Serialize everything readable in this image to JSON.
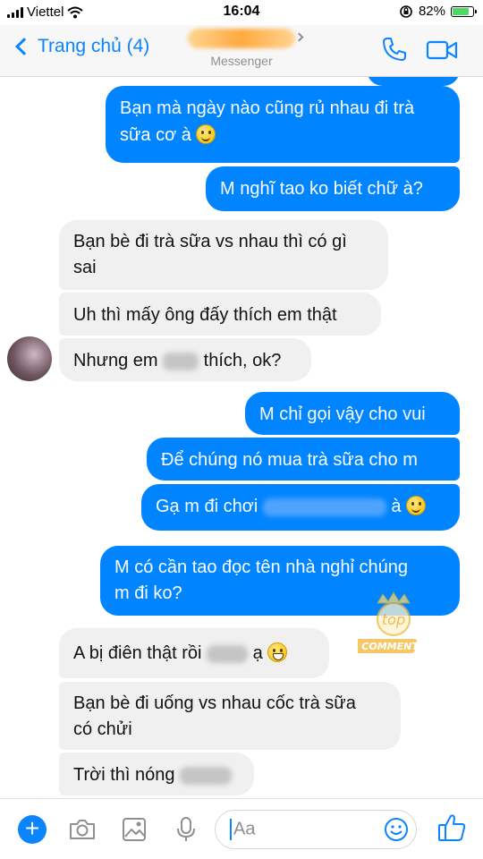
{
  "status_bar": {
    "carrier": "Viettel",
    "time": "16:04",
    "battery": "82%",
    "battery_level": 0.82
  },
  "nav": {
    "back_label": "Trang chủ (4)",
    "subtitle": "Messenger",
    "icons": {
      "call": "phone-icon",
      "video": "video-camera-icon"
    }
  },
  "messages": [
    {
      "id": "m1",
      "side": "out",
      "lines": [
        "Bạn mà ngày nào cũng rủ nhau đi trà",
        "sữa cơ à"
      ],
      "emoji": "smile"
    },
    {
      "id": "m2",
      "side": "out",
      "text": "M nghĩ tao ko biết chữ à?"
    },
    {
      "id": "m3",
      "side": "in",
      "lines": [
        "Bạn bè đi trà sữa vs nhau thì có gì",
        "sai"
      ]
    },
    {
      "id": "m4",
      "side": "in",
      "text": "Uh thì mấy ông đấy thích em thật"
    },
    {
      "id": "m5",
      "side": "in",
      "before": "Nhưng em",
      "after": "thích, ok?"
    },
    {
      "id": "m6",
      "side": "out",
      "text": "M chỉ gọi vậy cho vui"
    },
    {
      "id": "m7",
      "side": "out",
      "text": "Để chúng nó mua trà sữa cho m"
    },
    {
      "id": "m8",
      "side": "out",
      "before": "Gạ m đi chơi",
      "after": "à",
      "emoji": "smile"
    },
    {
      "id": "m9",
      "side": "out",
      "lines": [
        "M có cần tao đọc tên nhà nghỉ chúng",
        "m đi ko?"
      ]
    },
    {
      "id": "m10",
      "side": "in",
      "before": "A bị điên thật rồi",
      "after": "ạ",
      "emoji": "grin"
    },
    {
      "id": "m11",
      "side": "in",
      "lines": [
        "Bạn bè đi uống vs nhau cốc trà sữa",
        "có chửi"
      ]
    },
    {
      "id": "m12",
      "side": "in",
      "before": "Trời thì nóng"
    }
  ],
  "watermark": {
    "top": "top",
    "brand": "COMMENTS"
  },
  "composer": {
    "placeholder": "Aa",
    "icons": [
      "plus-icon",
      "camera-icon",
      "image-icon",
      "microphone-icon",
      "emoji-icon",
      "thumbs-up-icon"
    ]
  },
  "colors": {
    "accent": "#0a84ff",
    "outgoing_bubble": "#0084ff",
    "incoming_bubble": "#f1f0f0"
  }
}
